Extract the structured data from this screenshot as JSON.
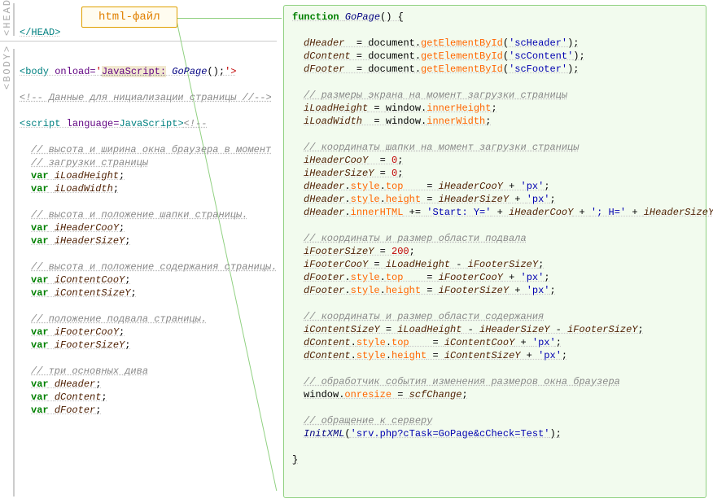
{
  "title": "html-файл",
  "labels": {
    "head": "<HEAD>",
    "body": "<BODY>"
  },
  "left": {
    "l1": "</HEAD>",
    "l2a": "<body",
    "l2b": " onload=",
    "l2c": "'",
    "l2d": "JavaScript:",
    "l2e": " GoPage",
    "l2f": "();",
    "l2g": "'>",
    "l3": "<!-- Данные для нициализации страницы //-->",
    "l4a": "<script",
    "l4b": " language=",
    "l4c": "JavaScript",
    "l4d": ">",
    "l4e": "<!--",
    "c1": "// высота и ширина окна браузера в момент",
    "c1b": "// загрузки страницы",
    "v1": "iLoadHeight",
    "v2": "iLoadWidth",
    "c2": "// высота и положение шапки страницы.",
    "v3": "iHeaderCooY",
    "v4": "iHeaderSizeY",
    "c3": "// высота и положение содержания страницы.",
    "v5": "iContentCooY",
    "v6": "iContentSizeY",
    "c4": "// положение подвала страницы.",
    "v7": "iFooterCooY",
    "v8": "iFooterSizeY",
    "c5": "// три основных дива",
    "v9": "dHeader",
    "v10": "dContent",
    "v11": "dFooter",
    "kw_var": "var"
  },
  "right": {
    "fn_kw": "function",
    "fn_name": "GoPage",
    "fn_sig": "() {",
    "a1": "dHeader",
    "a2": "dContent",
    "a3": "dFooter",
    "doc": "document",
    "geb": "getElementById",
    "s1": "'scHeader'",
    "s2": "'scContent'",
    "s3": "'scFooter'",
    "cm1": "// размеры экрана на момент загрузки страницы",
    "win": "window",
    "ih": "innerHeight",
    "iw": "innerWidth",
    "v_lh": "iLoadHeight",
    "v_lw": "iLoadWidth",
    "cm2": "// координаты шапки на момент загрузки страницы",
    "v_hcy": "iHeaderCooY",
    "v_hsy": "iHeaderSizeY",
    "zero": "0",
    "n200": "200",
    "style": "style",
    "top": "top",
    "height": "height",
    "innerHTML": "innerHTML",
    "px": "'px'",
    "starty": "'Start: Y='",
    "heq": "'; H='",
    "cm3": "// координаты и размер области подвала",
    "v_fsy": "iFooterSizeY",
    "v_fcy": "iFooterCooY",
    "cm4": "// координаты и размер области содержания",
    "v_csy": "iContentSizeY",
    "v_ccy": "iContentCooY",
    "cm5": "// обработчик события изменения размеров окна браузера",
    "onresize": "onresize",
    "scf": "scfChange",
    "cm6": "// обращение к серверу",
    "initxml": "InitXML",
    "srv": "'srv.php?cTask=GoPage&cCheck=Test'",
    "close": "}"
  }
}
